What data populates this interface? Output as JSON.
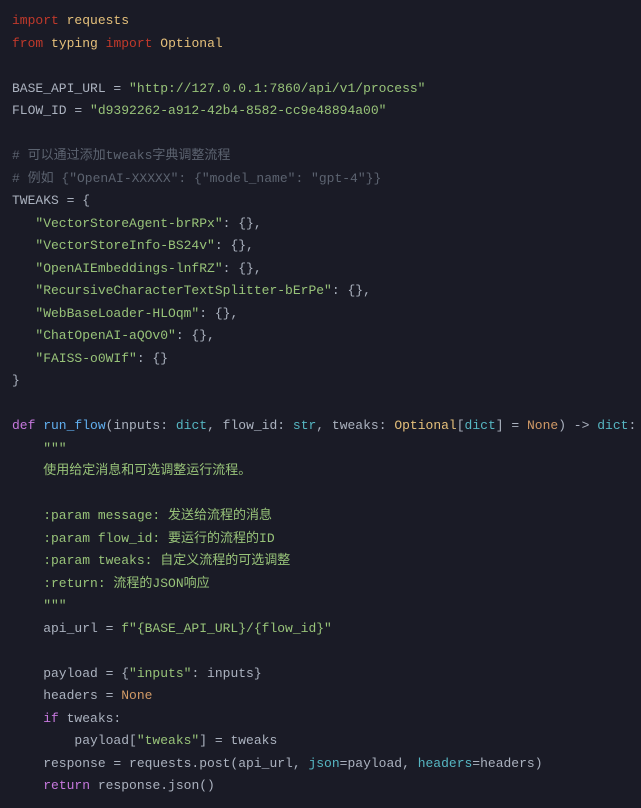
{
  "l1_import": "import",
  "l1_requests": "requests",
  "l2_from": "from",
  "l2_typing": "typing",
  "l2_import": "import",
  "l2_optional": "Optional",
  "l4_var": "BASE_API_URL",
  "l4_eq": " = ",
  "l4_str": "\"http://127.0.0.1:7860/api/v1/process\"",
  "l5_var": "FLOW_ID",
  "l5_eq": " = ",
  "l5_str": "\"d9392262-a912-42b4-8582-cc9e48894a00\"",
  "l7_cmt": "# 可以通过添加tweaks字典调整流程",
  "l8_cmt": "# 例如 {\"OpenAI-XXXXX\": {\"model_name\": \"gpt-4\"}}",
  "l9_var": "TWEAKS",
  "l9_rest": " = {",
  "l10": "   \"VectorStoreAgent-brRPx\"",
  "l10b": ": {},",
  "l11": "   \"VectorStoreInfo-BS24v\"",
  "l11b": ": {},",
  "l12": "   \"OpenAIEmbeddings-lnfRZ\"",
  "l12b": ": {},",
  "l13": "   \"RecursiveCharacterTextSplitter-bErPe\"",
  "l13b": ": {},",
  "l14": "   \"WebBaseLoader-HLOqm\"",
  "l14b": ": {},",
  "l15": "   \"ChatOpenAI-aQOv0\"",
  "l15b": ": {},",
  "l16": "   \"FAISS-o0WIf\"",
  "l16b": ": {}",
  "l17": "}",
  "l19_def": "def",
  "l19_fn": " run_flow",
  "l19_p1": "(inputs: ",
  "l19_t1": "dict",
  "l19_p2": ", flow_id: ",
  "l19_t2": "str",
  "l19_p3": ", tweaks: ",
  "l19_t3": "Optional",
  "l19_p4": "[",
  "l19_t4": "dict",
  "l19_p5": "] = ",
  "l19_none": "None",
  "l19_p6": ") -> ",
  "l19_t5": "dict",
  "l19_p7": ":",
  "l20": "    \"\"\"",
  "l21": "    使用给定消息和可选调整运行流程。",
  "l23": "    :param message: 发送给流程的消息",
  "l24": "    :param flow_id: 要运行的流程的ID",
  "l25": "    :param tweaks: 自定义流程的可选调整",
  "l26a": "    :return:",
  "l26b": " 流程的JSON响应",
  "l27": "    \"\"\"",
  "l28a": "    api_url = ",
  "l28b": "f\"{BASE_API_URL}/{flow_id}\"",
  "l30a": "    payload = {",
  "l30b": "\"inputs\"",
  "l30c": ": inputs}",
  "l31a": "    headers = ",
  "l31b": "None",
  "l32a": "    ",
  "l32b": "if",
  "l32c": " tweaks:",
  "l33a": "        payload[",
  "l33b": "\"tweaks\"",
  "l33c": "] = tweaks",
  "l34a": "    response = requests.post(api_url, ",
  "l34b": "json",
  "l34c": "=payload, ",
  "l34d": "headers",
  "l34e": "=headers)",
  "l35a": "    ",
  "l35b": "return",
  "l35c": " response.json()"
}
